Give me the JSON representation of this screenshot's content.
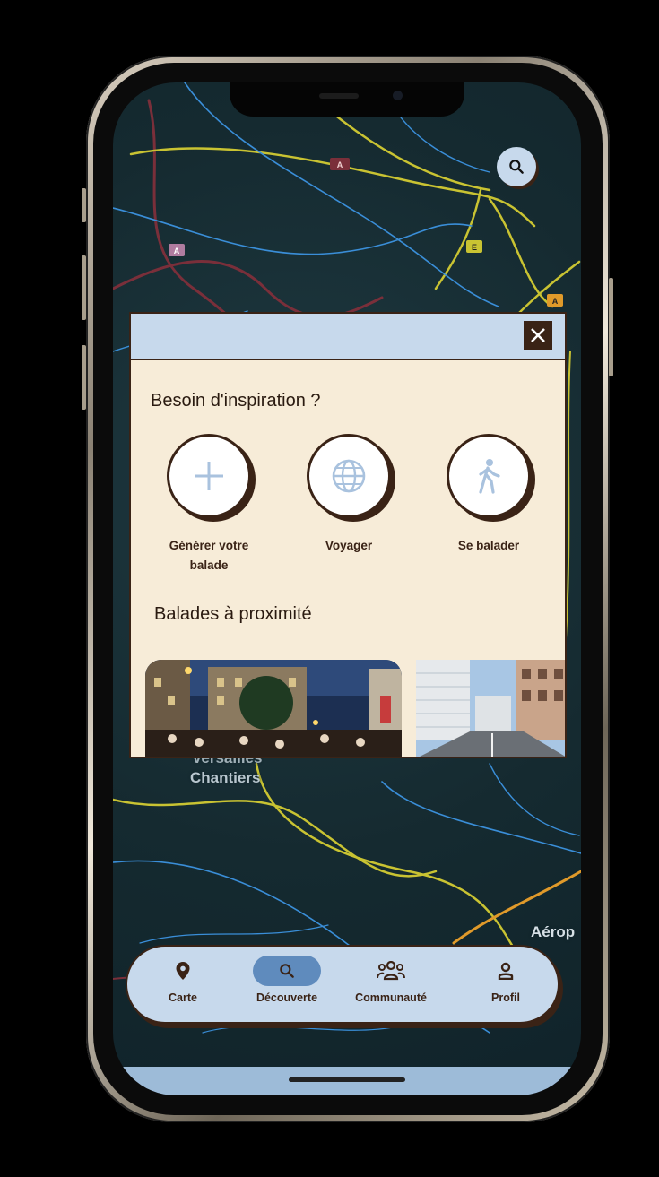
{
  "map": {
    "labels": [
      "Versailles",
      "Chantiers",
      "Aérop"
    ],
    "road_badges": [
      "A",
      "A",
      "E",
      "A"
    ]
  },
  "popup": {
    "section_inspiration": "Besoin d'inspiration ?",
    "options": [
      {
        "label_line1": "Générer votre",
        "label_line2": "balade",
        "icon": "plus-icon"
      },
      {
        "label_line1": "Voyager",
        "label_line2": "",
        "icon": "globe-icon"
      },
      {
        "label_line1": "Se balader",
        "label_line2": "",
        "icon": "walking-icon"
      }
    ],
    "section_nearby": "Balades à proximité"
  },
  "nav": {
    "items": [
      {
        "label": "Carte",
        "icon": "map-pin-icon",
        "active": false
      },
      {
        "label": "Découverte",
        "icon": "search-icon",
        "active": true
      },
      {
        "label": "Communauté",
        "icon": "community-icon",
        "active": false
      },
      {
        "label": "Profil",
        "icon": "profile-icon",
        "active": false
      }
    ]
  },
  "colors": {
    "accent_blue": "#c7d9ec",
    "active_blue": "#5f8bbd",
    "cream": "#f7ecd8",
    "brown": "#3a2316",
    "map_bg": "#152a30"
  }
}
